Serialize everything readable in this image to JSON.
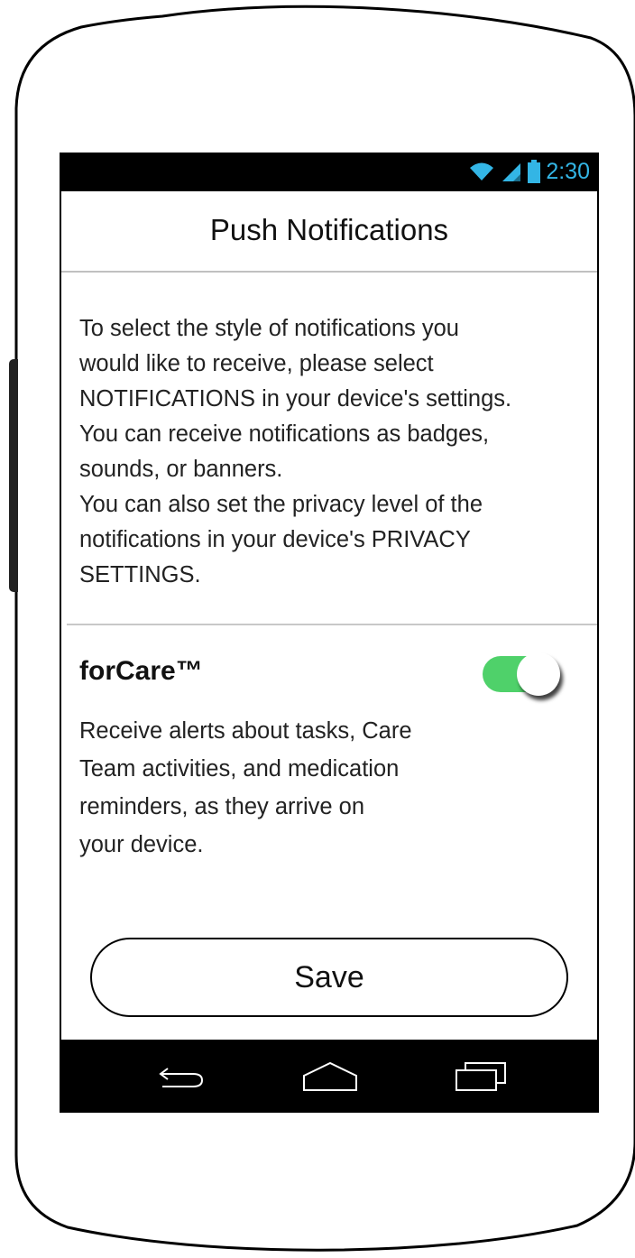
{
  "status_bar": {
    "time": "2:30",
    "icons": [
      "wifi-icon",
      "signal-icon",
      "battery-icon"
    ],
    "accent_color": "#33b5e5"
  },
  "header": {
    "title": "Push Notifications"
  },
  "instructions": {
    "text": "To select the style of notifications you\nwould like to receive, please select\nNOTIFICATIONS in your device's settings.\nYou can receive notifications as badges,\nsounds, or banners.\nYou can also set the privacy level of the\nnotifications in your device's PRIVACY\nSETTINGS."
  },
  "forcare": {
    "title": "forCare™",
    "toggle_on": true,
    "toggle_color": "#4fd16a",
    "description": "Receive alerts about tasks, Care\nTeam activities, and medication\nreminders, as they arrive on\nyour device."
  },
  "save_button": {
    "label": "Save"
  },
  "nav_bar": {
    "buttons": [
      "back-icon",
      "home-icon",
      "recent-apps-icon"
    ]
  }
}
